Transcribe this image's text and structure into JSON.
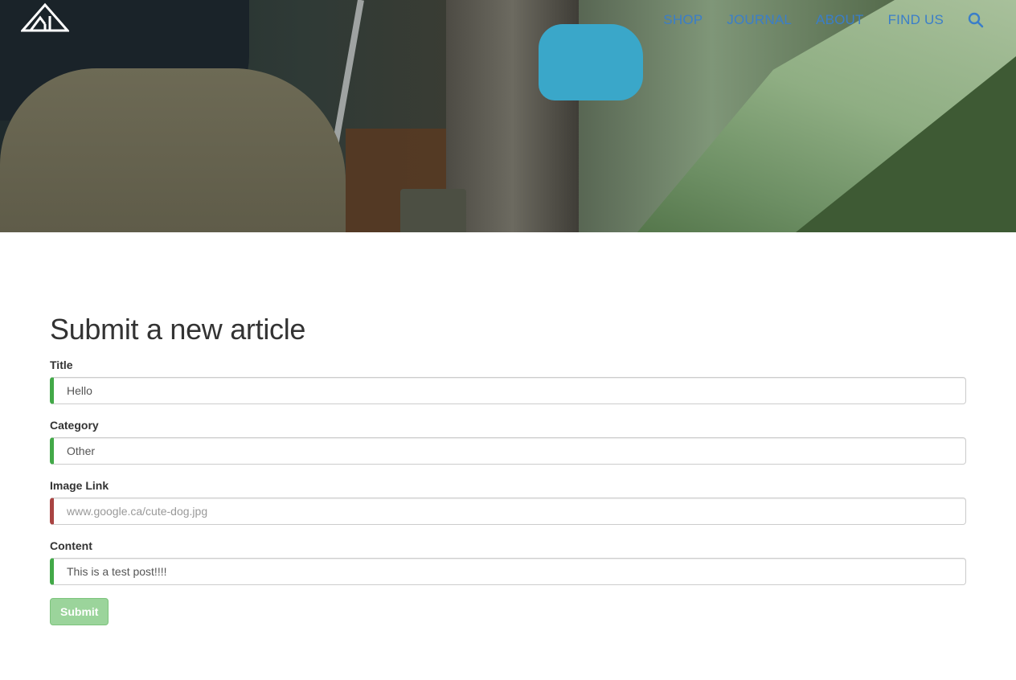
{
  "nav": {
    "items": [
      {
        "label": "SHOP"
      },
      {
        "label": "JOURNAL"
      },
      {
        "label": "ABOUT"
      },
      {
        "label": "FIND US"
      }
    ],
    "search_icon": "search-icon",
    "link_color": "#3a7ec9"
  },
  "form": {
    "title": "Submit a new article",
    "fields": [
      {
        "label": "Title",
        "value": "Hello",
        "placeholder": "",
        "status": "valid"
      },
      {
        "label": "Category",
        "value": "Other",
        "placeholder": "",
        "status": "valid"
      },
      {
        "label": "Image Link",
        "value": "",
        "placeholder": "www.google.ca/cute-dog.jpg",
        "status": "invalid"
      },
      {
        "label": "Content",
        "value": "This is a test post!!!!",
        "placeholder": "",
        "status": "valid"
      }
    ],
    "submit_label": "Submit",
    "submit_disabled": true
  },
  "colors": {
    "valid": "#42a948",
    "invalid": "#a94442",
    "submit_bg": "#9bd49b"
  }
}
